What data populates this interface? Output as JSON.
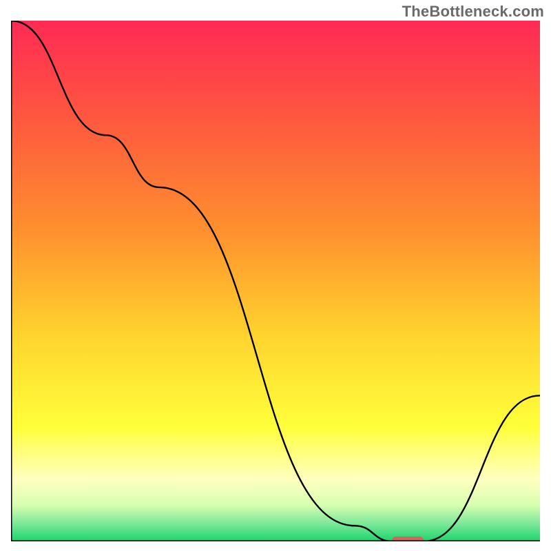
{
  "watermark": "TheBottleneck.com",
  "chart_data": {
    "type": "line",
    "title": "",
    "xlabel": "",
    "ylabel": "",
    "xlim": [
      0,
      100
    ],
    "ylim": [
      0,
      100
    ],
    "grid": false,
    "legend": false,
    "gradient_stops": [
      {
        "offset": 0.0,
        "color": "#ff2a55"
      },
      {
        "offset": 0.2,
        "color": "#ff5b3e"
      },
      {
        "offset": 0.4,
        "color": "#ff8f2e"
      },
      {
        "offset": 0.6,
        "color": "#ffd22e"
      },
      {
        "offset": 0.78,
        "color": "#ffff3a"
      },
      {
        "offset": 0.88,
        "color": "#ffffbf"
      },
      {
        "offset": 0.93,
        "color": "#d8ffb0"
      },
      {
        "offset": 0.965,
        "color": "#7fe89a"
      },
      {
        "offset": 1.0,
        "color": "#1ad66a"
      }
    ],
    "series": [
      {
        "name": "bottleneck-curve",
        "x": [
          0,
          18,
          28,
          65,
          72,
          78,
          100
        ],
        "values": [
          100,
          78,
          68,
          3,
          0,
          0,
          28
        ]
      }
    ],
    "marker": {
      "name": "optimum-marker",
      "x_center": 75,
      "y": 0,
      "width": 6,
      "color": "#d4645e"
    }
  }
}
